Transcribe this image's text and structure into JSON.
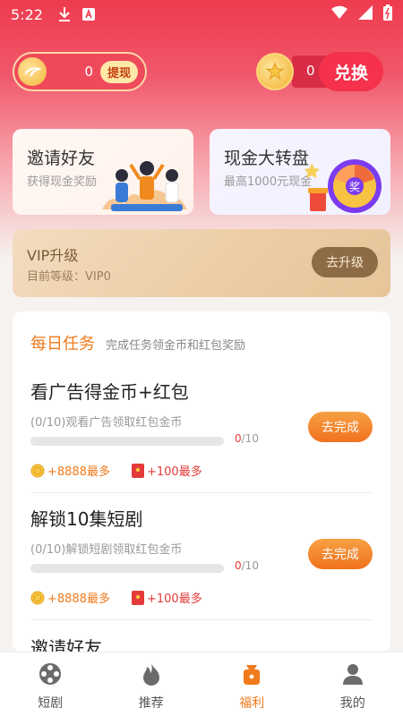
{
  "status_bar": {
    "time": "5:22"
  },
  "account": {
    "coins": "0",
    "withdraw_label": "提现",
    "cash": "0",
    "exchange_label": "兑换"
  },
  "promos": {
    "invite": {
      "title": "邀请好友",
      "subtitle": "获得现金奖励"
    },
    "wheel": {
      "title": "现金大转盘",
      "subtitle": "最高1000元现金",
      "badge": "奖"
    }
  },
  "vip": {
    "title": "VIP升级",
    "level_text": "目前等级：VIP0",
    "upgrade_label": "去升级"
  },
  "daily_tasks": {
    "title": "每日任务",
    "description": "完成任务领金币和红包奖励",
    "items": [
      {
        "name": "看广告得金币+红包",
        "detail": "(0/10)观看广告领取红包金币",
        "progress_current": "0",
        "progress_total": "/10",
        "progress_value": 0,
        "button": "去完成",
        "coin_reward": "+8888最多",
        "red_reward": "+100最多"
      },
      {
        "name": "解锁10集短剧",
        "detail": "(0/10)解锁短剧领取红包金币",
        "progress_current": "0",
        "progress_total": "/10",
        "progress_value": 0,
        "button": "去完成",
        "coin_reward": "+8888最多",
        "red_reward": "+100最多"
      }
    ],
    "next_item_partial": "邀请好友"
  },
  "bottom_nav": [
    {
      "label": "短剧",
      "icon": "film-reel-icon"
    },
    {
      "label": "推荐",
      "icon": "flame-icon"
    },
    {
      "label": "福利",
      "icon": "gift-bag-icon"
    },
    {
      "label": "我的",
      "icon": "user-icon"
    }
  ],
  "colors": {
    "header_red": "#ef3b4e",
    "accent_orange": "#f07a1c",
    "reward_red": "#e33a3a",
    "vip_gold": "#8c6b45"
  }
}
